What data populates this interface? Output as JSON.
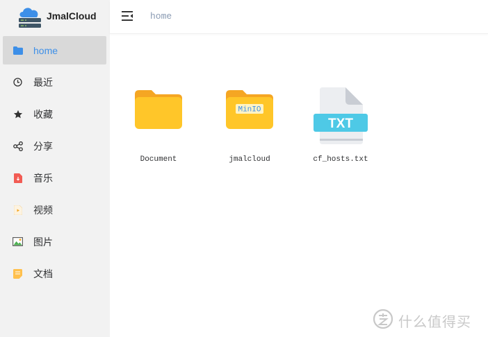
{
  "app": {
    "name": "JmalCloud",
    "logo_icon": "cloud-server-icon"
  },
  "topbar": {
    "menu_icon": "menu-fold-icon",
    "breadcrumb": "home"
  },
  "sidebar": {
    "items": [
      {
        "label": "home",
        "icon": "folder-icon",
        "active": true
      },
      {
        "label": "最近",
        "icon": "clock-icon",
        "active": false
      },
      {
        "label": "收藏",
        "icon": "star-icon",
        "active": false
      },
      {
        "label": "分享",
        "icon": "share-icon",
        "active": false
      },
      {
        "label": "音乐",
        "icon": "music-file-icon",
        "active": false
      },
      {
        "label": "视频",
        "icon": "video-file-icon",
        "active": false
      },
      {
        "label": "图片",
        "icon": "image-icon",
        "active": false
      },
      {
        "label": "文档",
        "icon": "document-icon",
        "active": false
      }
    ]
  },
  "files": [
    {
      "name": "Document",
      "type": "folder"
    },
    {
      "name": "jmalcloud",
      "type": "folder",
      "badge": "MinIO"
    },
    {
      "name": "cf_hosts.txt",
      "type": "txt",
      "badge": "TXT"
    }
  ],
  "watermark": {
    "text": "什么值得买",
    "icon": "zhi-logo-icon"
  },
  "colors": {
    "active_text": "#3d8fe8",
    "folder": "#ffc629",
    "folder_tab": "#f5a623",
    "txt_badge": "#4ec9e6",
    "sidebar_bg": "#f2f2f2"
  }
}
